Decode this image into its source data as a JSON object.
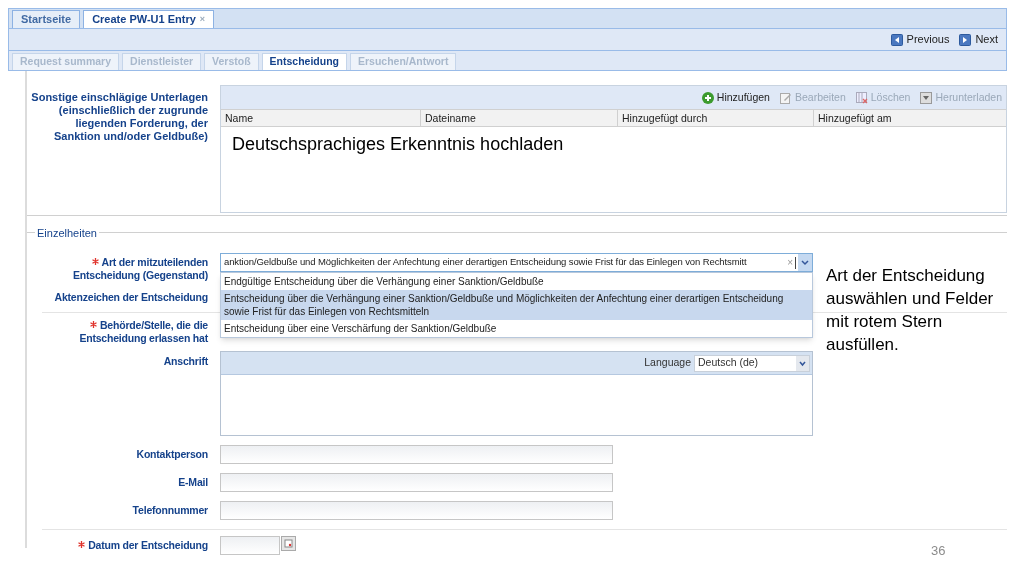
{
  "top_tabs": [
    {
      "label": "Startseite",
      "selected": false
    },
    {
      "label": "Create PW-U1 Entry",
      "selected": true,
      "close": "×"
    }
  ],
  "toolbar": [
    {
      "label": "Previous",
      "kind": "previous"
    },
    {
      "label": "Next",
      "kind": "next"
    }
  ],
  "form_tabs": [
    {
      "label": "Request summary",
      "selected": false
    },
    {
      "label": "Dienstleister",
      "selected": false
    },
    {
      "label": "Verstoß",
      "selected": false
    },
    {
      "label": "Entscheidung",
      "selected": true
    },
    {
      "label": "Ersuchen/Antwort",
      "selected": false
    }
  ],
  "attachments": {
    "label": "Sonstige einschlägige Unterlagen (einschließlich der zugrunde liegenden Forderung, der Sanktion und/oder Geldbuße)",
    "actions": [
      {
        "label": "Hinzufügen",
        "kind": "add",
        "disabled": false
      },
      {
        "label": "Bearbeiten",
        "kind": "edit",
        "disabled": true
      },
      {
        "label": "Löschen",
        "kind": "delete",
        "disabled": true
      },
      {
        "label": "Herunterladen",
        "kind": "download",
        "disabled": true
      }
    ],
    "columns": [
      "Name",
      "Dateiname",
      "Hinzugefügt durch",
      "Hinzugefügt am"
    ],
    "overlay_note": "Deutschsprachiges Erkenntnis hochladen"
  },
  "details": {
    "legend": "Einzelheiten",
    "fields": [
      {
        "kind": "combo",
        "label": "Art der mitzuteilenden Entscheidung (Gegenstand)",
        "required": true,
        "value": "anktion/Geldbuße und Möglichkeiten der Anfechtung einer derartigen Entscheidung sowie Frist für das Einlegen von Rechtsmitt",
        "clear": "×",
        "expanded": true,
        "options": [
          {
            "label": "Endgültige Entscheidung über die Verhängung einer Sanktion/Geldbuße",
            "selected": false
          },
          {
            "label": "Entscheidung über die Verhängung einer Sanktion/Geldbuße und Möglichkeiten der Anfechtung einer derartigen Entscheidung sowie Frist für das Einlegen von Rechtsmitteln",
            "selected": true
          },
          {
            "label": "Entscheidung über eine Verschärfung der Sanktion/Geldbuße",
            "selected": false
          }
        ]
      },
      {
        "kind": "covered",
        "label": "Aktenzeichen der Entscheidung",
        "required": false
      },
      {
        "kind": "covered",
        "label": "Behörde/Stelle, die die Entscheidung erlassen hat",
        "required": true
      },
      {
        "kind": "address",
        "label": "Anschrift",
        "required": false,
        "language_label": "Language",
        "language": "Deutsch (de)"
      },
      {
        "kind": "text",
        "label": "Kontaktperson",
        "required": false
      },
      {
        "kind": "text",
        "label": "E-Mail",
        "required": false
      },
      {
        "kind": "text",
        "label": "Telefonnummer",
        "required": false
      },
      {
        "kind": "date",
        "label": "Datum der Entscheidung",
        "required": true
      }
    ]
  },
  "annotation": [
    "Art der Entscheidung",
    "auswählen und Felder",
    "mit rotem Stern",
    "ausfüllen."
  ],
  "slide_number": "36"
}
